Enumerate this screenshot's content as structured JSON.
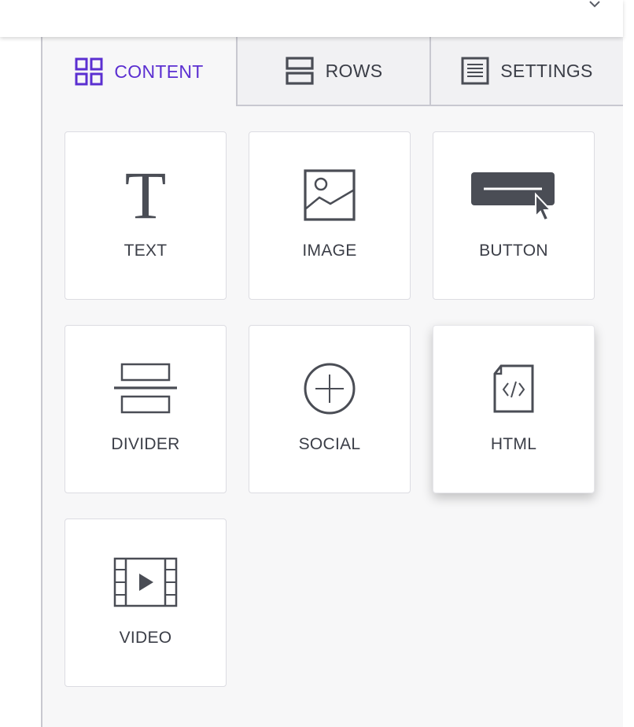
{
  "tabs": [
    {
      "label": "CONTENT",
      "icon": "grid-icon",
      "active": true
    },
    {
      "label": "ROWS",
      "icon": "rows-icon",
      "active": false
    },
    {
      "label": "SETTINGS",
      "icon": "settings-document-icon",
      "active": false
    }
  ],
  "tiles": [
    {
      "label": "TEXT",
      "icon": "text-t-icon"
    },
    {
      "label": "IMAGE",
      "icon": "image-icon"
    },
    {
      "label": "BUTTON",
      "icon": "button-cursor-icon"
    },
    {
      "label": "DIVIDER",
      "icon": "divider-icon"
    },
    {
      "label": "SOCIAL",
      "icon": "circle-plus-icon"
    },
    {
      "label": "HTML",
      "icon": "html-code-file-icon"
    },
    {
      "label": "VIDEO",
      "icon": "video-film-icon"
    }
  ],
  "colors": {
    "accent": "#5b2fd1",
    "icon": "#4a4d55",
    "text": "#3b3e47",
    "panel_bg": "#f7f7f8"
  }
}
